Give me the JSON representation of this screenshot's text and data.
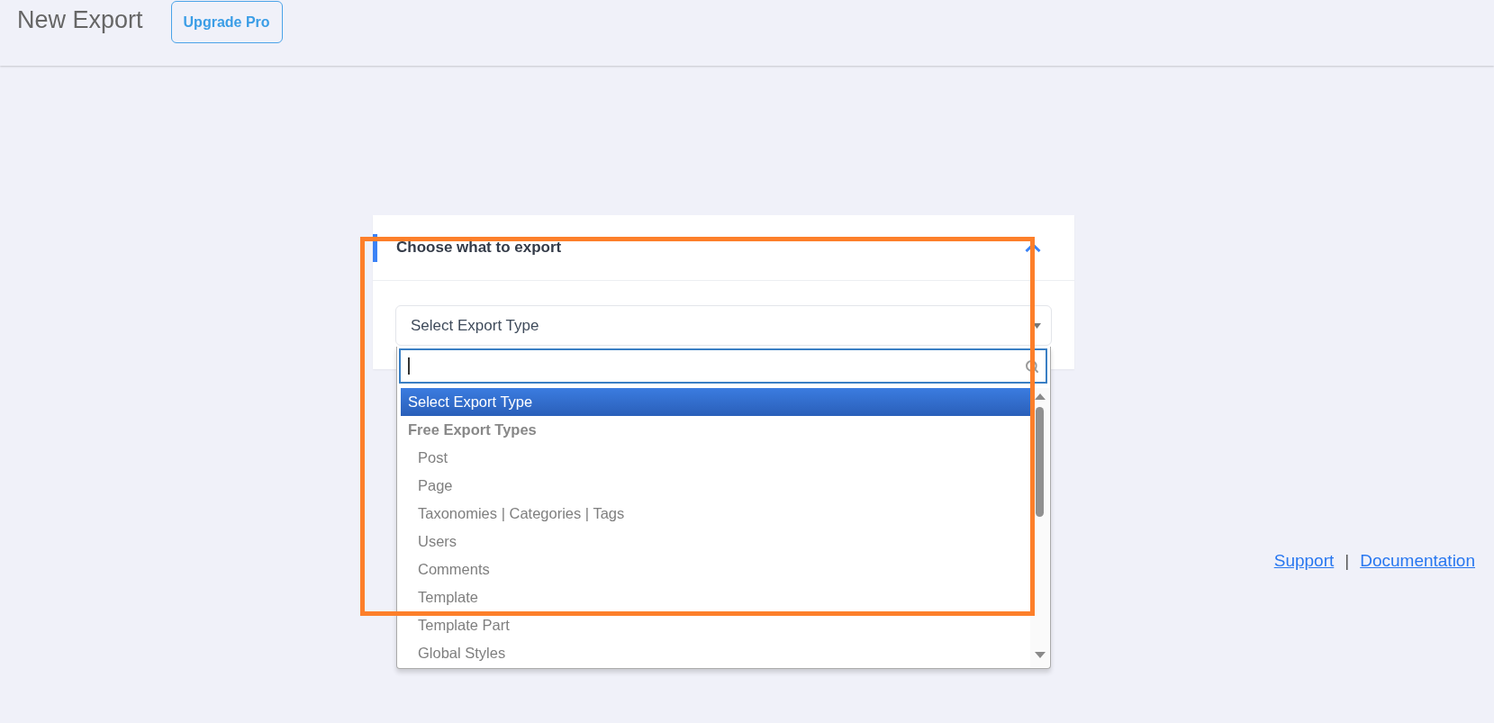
{
  "header": {
    "title": "New Export",
    "upgrade_button": "Upgrade Pro"
  },
  "panel": {
    "title": "Choose what to export",
    "expanded": true,
    "select": {
      "value": "Select Export Type",
      "open": true,
      "search": {
        "focused": true
      },
      "options": [
        {
          "kind": "option",
          "label": "Select Export Type",
          "selected": true
        },
        {
          "kind": "group",
          "label": "Free Export Types",
          "children": [
            {
              "label": "Post",
              "selected": false
            },
            {
              "label": "Page",
              "selected": false
            },
            {
              "label": "Taxonomies | Categories | Tags",
              "selected": false
            },
            {
              "label": "Users",
              "selected": false
            },
            {
              "label": "Comments",
              "selected": false
            },
            {
              "label": "Template",
              "selected": false
            },
            {
              "label": "Template Part",
              "selected": false
            },
            {
              "label": "Global Styles",
              "selected": false
            }
          ]
        }
      ]
    }
  },
  "footer": {
    "links": [
      "Support",
      "Documentation"
    ],
    "separator": "|"
  }
}
